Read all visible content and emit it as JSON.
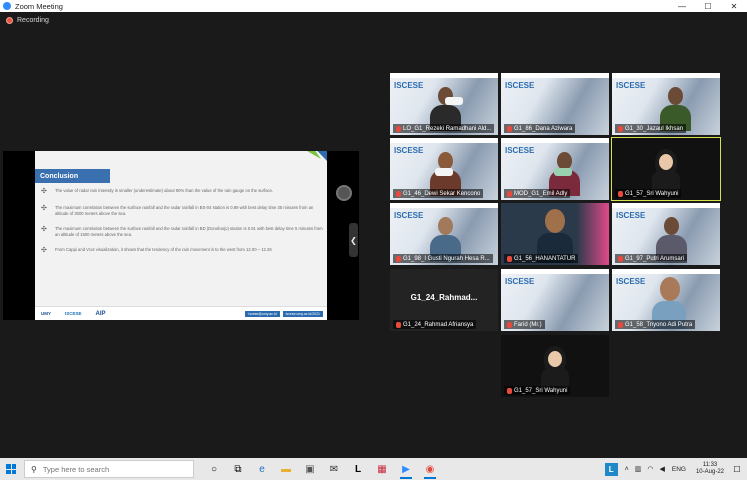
{
  "window": {
    "title": "Zoom Meeting",
    "controls": {
      "minimize": "—",
      "maximize": "☐",
      "close": "✕"
    }
  },
  "recording": {
    "label": "Recording"
  },
  "slide": {
    "heading": "Conclusion",
    "bullets": [
      "The value of radar rain intensity is smaller (underestimate) about 90% than the value of the rain gauge on the surface.",
      "The maximum correlation between the surface rainfall and the radar rainfall in BS-04 station is 0.89 with best delay time 35 minutes from an altitude of 3000 meters above the sea.",
      "The maximum correlation between the surface rainfall and the radar rainfall in BD (Donoharjo) station is 0.91 with best delay time 5 minutes from an altitude of 1500 meters above the sea.",
      "From Cappi and Vcut visualization, it shows that the tendency of the rain movement is to the west from 12.00 – 12.26"
    ],
    "footer": {
      "logo_umy": "UMY",
      "logo_iscese": "ISCESE",
      "logo_aip": "AIP",
      "link_1": "iscese@umy.ac.id",
      "link_2": "iscese.umy.ac.id/2021"
    }
  },
  "gallery": {
    "banner": "ISCESE",
    "big_name": "G1_24_Rahmad...",
    "participants": [
      "LO_G1_Rezeki Ramadhani Ald...",
      "G1_86_Dana Aziwara",
      "G1_30_Jazaul Ikhsan",
      "G1_46_Dewi Sekar Kencono",
      "MOD_G1_Emil Adly",
      "G1_57_Sri Wahyuni",
      "G1_98_I Gusti Ngurah Hesa R...",
      "G1_56_HANANTATUR",
      "G1_97_Putri Arumsari",
      "G1_24_Rahmad Afriansya",
      "Farid (Mr.)",
      "G1_58_Triyono Adi Putra",
      "G1_57_Sri Wahyuni"
    ]
  },
  "taskbar": {
    "search_placeholder": "Type here to search",
    "language": "ENG",
    "time": "11:33",
    "date": "10-Aug-22",
    "tray_app": "L"
  }
}
